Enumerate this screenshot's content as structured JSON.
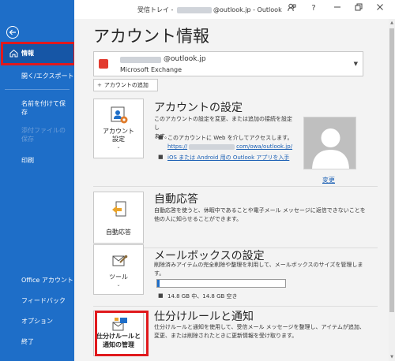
{
  "titlebar": {
    "title_prefix": "受信トレイ - ",
    "title_email": "@outlook.jp",
    "title_suffix": " - Outlook",
    "help": "?"
  },
  "sidebar": {
    "items": [
      {
        "label": "情報"
      },
      {
        "label": "開く/エクスポート"
      },
      {
        "label": "名前を付けて保存"
      },
      {
        "label": "添付ファイルの保存"
      },
      {
        "label": "印刷"
      },
      {
        "label": "Office アカウント"
      },
      {
        "label": "フィードバック"
      },
      {
        "label": "オプション"
      },
      {
        "label": "終了"
      }
    ]
  },
  "main": {
    "title": "アカウント情報",
    "account": {
      "email": "@outlook.jp",
      "type": "Microsoft Exchange"
    },
    "add_account": "アカウントの追加",
    "sections": {
      "settings": {
        "button_line1": "アカウント",
        "button_line2": "設定",
        "title": "アカウントの設定",
        "desc_line1": "このアカウントの設定を変更、または追加の接続を設定し",
        "desc_line2": "ます。",
        "bullet1": "このアカウントに Web を介してアクセスします。",
        "link1_prefix": "https://",
        "link1_suffix": "com/owa/outlook.jp/",
        "link2": "iOS または Android 用の Outlook アプリを入手",
        "change": "変更"
      },
      "auto_reply": {
        "button": "自動応答",
        "title": "自動応答",
        "desc_line1": "自動応答を使うと、休暇中であることや電子メール メッセージに返信できないことを",
        "desc_line2": "他の人に知らせることができます。"
      },
      "mailbox": {
        "button": "ツール",
        "title": "メールボックスの設定",
        "desc": "削除済みアイテムの完全削除や整理を利用して、メールボックスのサイズを管理しま",
        "desc_line2": "す。",
        "usage": "14.8 GB 中、14.8 GB 空き",
        "usage_fraction": 0.02
      },
      "rules": {
        "button_line1": "仕分けルールと",
        "button_line2": "通知の管理",
        "title": "仕分けルールと通知",
        "desc_line1": "仕分けルールと通知を使用して、受信メール メッセージを整理し、アイテムが追加、",
        "desc_line2": "変更、または削除されたときに更新情報を受け取ります。"
      }
    }
  },
  "colors": {
    "sidebar": "#1e6ec8",
    "sidebar_active": "#1656a6",
    "highlight": "#e0191d",
    "link": "#1a5fb4"
  }
}
